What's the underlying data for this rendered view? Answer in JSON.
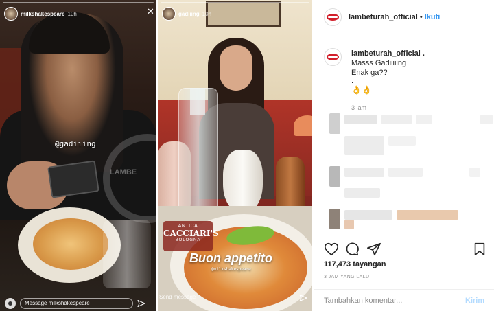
{
  "story_left": {
    "username": "milkshakespeare",
    "time": "10h",
    "mention": "@gadiiing",
    "watermark": "LAMBE",
    "message_placeholder": "Message milkshakespeare"
  },
  "story_mid": {
    "username": "gadiiing",
    "time": "10h",
    "menu_line_1": "ANTICA",
    "menu_line_2": "CACCIARI'S",
    "menu_line_3": "BOLOGNA",
    "overlay_title": "Buon appetito",
    "overlay_mention": "@milkshakespeare",
    "message_placeholder": "Send message"
  },
  "post": {
    "header": {
      "username": "lambeturah_official",
      "dot": "•",
      "follow_label": "Ikuti"
    },
    "caption": {
      "username": "lambeturah_official",
      "suffix": ".",
      "line1": "Masss Gadiiiiing",
      "line2": "Enak ga??",
      "line3": ".",
      "emoji": "👌👌",
      "time": "3 jam"
    },
    "views": "117,473 tayangan",
    "posted_time": "3 JAM YANG LALU",
    "comment_placeholder": "Tambahkan komentar...",
    "send_label": "Kirim",
    "colors": {
      "link_blue": "#3897f0",
      "send_disabled": "#b3dbff",
      "brand_red": "#d21f2b"
    },
    "icons": [
      "heart-icon",
      "comment-icon",
      "share-icon",
      "bookmark-icon"
    ]
  }
}
